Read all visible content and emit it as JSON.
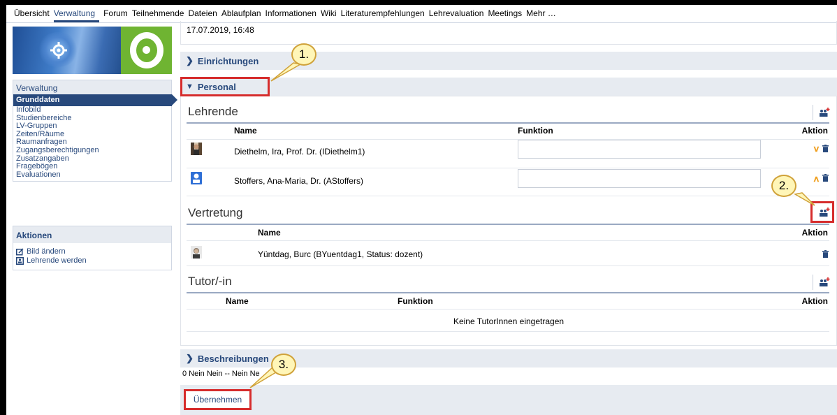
{
  "topnav": {
    "tabs": [
      "Übersicht",
      "Verwaltung",
      "Forum",
      "Teilnehmende",
      "Dateien",
      "Ablaufplan",
      "Informationen",
      "Wiki",
      "Literaturempfehlungen",
      "Lehrevaluation",
      "Meetings",
      "Mehr …"
    ],
    "active_tab": "Verwaltung"
  },
  "sidebar": {
    "section_title": "Verwaltung",
    "items": [
      "Grunddaten",
      "Infobild",
      "Studienbereiche",
      "LV-Gruppen",
      "Zeiten/Räume",
      "Raumanfragen",
      "Zugangsberechtigungen",
      "Zusatzangaben",
      "Fragebögen",
      "Evaluationen"
    ],
    "active_item": "Grunddaten"
  },
  "actions": {
    "title": "Aktionen",
    "items": [
      {
        "label": "Bild ändern",
        "icon": "edit-image-icon"
      },
      {
        "label": "Lehrende werden",
        "icon": "person-card-icon"
      }
    ]
  },
  "main": {
    "date": "17.07.2019, 16:48",
    "sections": {
      "einrichtungen": "Einrichtungen",
      "personal": "Personal",
      "beschreibungen": "Beschreibungen"
    },
    "lehrende": {
      "title": "Lehrende",
      "headers": {
        "name": "Name",
        "funktion": "Funktion",
        "aktion": "Aktion"
      },
      "rows": [
        {
          "name": "Diethelm, Ira, Prof. Dr. (IDiethelm1)",
          "funktion": ""
        },
        {
          "name": "Stoffers, Ana-Maria, Dr. (AStoffers)",
          "funktion": ""
        }
      ]
    },
    "vertretung": {
      "title": "Vertretung",
      "headers": {
        "name": "Name",
        "aktion": "Aktion"
      },
      "rows": [
        {
          "name": "Yüntdag, Burc (BYuentdag1, Status: dozent)"
        }
      ]
    },
    "tutor": {
      "title": "Tutor/-in",
      "headers": {
        "name": "Name",
        "funktion": "Funktion",
        "aktion": "Aktion"
      },
      "empty_text": "Keine TutorInnen eingetragen"
    },
    "beschreibungen_text": "0 Nein Nein -- Nein Ne",
    "submit_label": "Übernehmen"
  },
  "annotations": {
    "callout_1": "1.",
    "callout_2": "2.",
    "callout_3": "3.",
    "highlight_color": "#d62c2c",
    "callout_fill": "#fff6b8"
  },
  "colors": {
    "accent": "#28497c",
    "panel_header": "#e7ebf1",
    "sort_arrow": "#f0a020"
  }
}
